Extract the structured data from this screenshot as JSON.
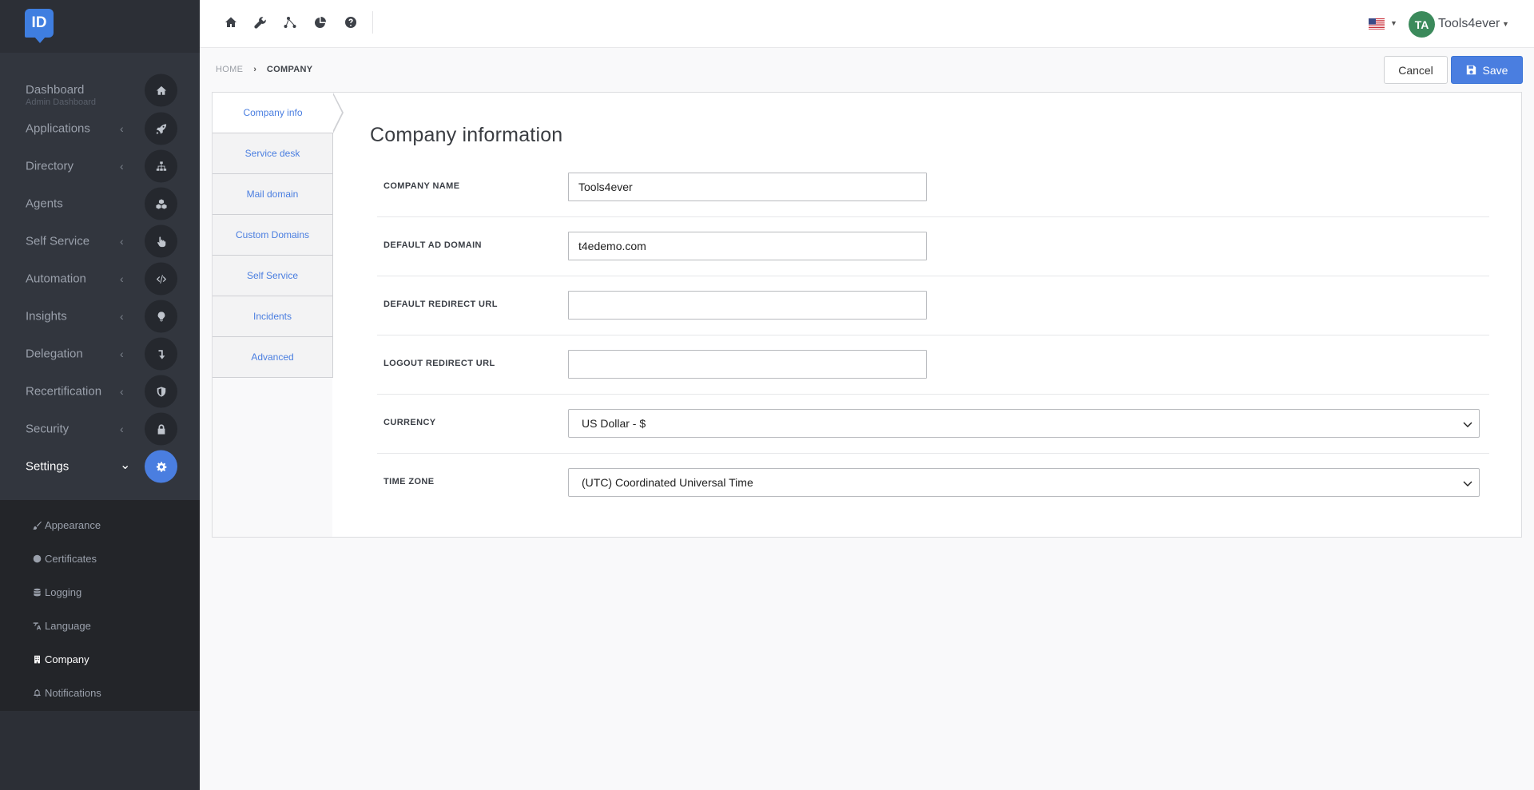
{
  "app": {
    "logo_text": "ID"
  },
  "sidebar": {
    "items": [
      {
        "label": "Dashboard",
        "sublabel": "Admin Dashboard",
        "icon": "home-icon",
        "has_arrow": false
      },
      {
        "label": "Applications",
        "icon": "rocket-icon",
        "has_arrow": true
      },
      {
        "label": "Directory",
        "icon": "sitemap-icon",
        "has_arrow": true
      },
      {
        "label": "Agents",
        "icon": "cubes-icon",
        "has_arrow": false
      },
      {
        "label": "Self Service",
        "icon": "hand-pointer-icon",
        "has_arrow": true
      },
      {
        "label": "Automation",
        "icon": "code-icon",
        "has_arrow": true
      },
      {
        "label": "Insights",
        "icon": "lightbulb-icon",
        "has_arrow": true
      },
      {
        "label": "Delegation",
        "icon": "level-down-icon",
        "has_arrow": true
      },
      {
        "label": "Recertification",
        "icon": "shield-icon",
        "has_arrow": true
      },
      {
        "label": "Security",
        "icon": "lock-icon",
        "has_arrow": true
      },
      {
        "label": "Settings",
        "icon": "cog-icon",
        "has_arrow": true,
        "active": true
      }
    ],
    "arrow_collapsed": "‹",
    "arrow_expanded": "⌄",
    "submenu": [
      {
        "label": "Appearance",
        "icon": "brush-icon"
      },
      {
        "label": "Certificates",
        "icon": "circle-icon"
      },
      {
        "label": "Logging",
        "icon": "database-icon"
      },
      {
        "label": "Language",
        "icon": "language-icon"
      },
      {
        "label": "Company",
        "icon": "building-icon",
        "active": true
      },
      {
        "label": "Notifications",
        "icon": "bell-icon"
      }
    ]
  },
  "topbar": {
    "icons": [
      "home-icon",
      "wrench-icon",
      "share-nodes-icon",
      "pie-chart-icon",
      "question-circle-icon"
    ],
    "language_flag": "us-flag-icon",
    "user_initials": "TA",
    "user_name": "Tools4ever",
    "caret": "▼"
  },
  "breadcrumb": {
    "home": "HOME",
    "separator": "›",
    "current": "COMPANY"
  },
  "actions": {
    "cancel_label": "Cancel",
    "save_label": "Save"
  },
  "tabs": [
    {
      "label": "Company info",
      "active": true
    },
    {
      "label": "Service desk"
    },
    {
      "label": "Mail domain"
    },
    {
      "label": "Custom Domains"
    },
    {
      "label": "Self Service"
    },
    {
      "label": "Incidents"
    },
    {
      "label": "Advanced"
    }
  ],
  "form": {
    "title": "Company information",
    "company_name": {
      "label": "COMPANY NAME",
      "value": "Tools4ever"
    },
    "default_ad_domain": {
      "label": "DEFAULT AD DOMAIN",
      "value": "t4edemo.com"
    },
    "default_redirect_url": {
      "label": "DEFAULT REDIRECT URL",
      "value": ""
    },
    "logout_redirect_url": {
      "label": "LOGOUT REDIRECT URL",
      "value": ""
    },
    "currency": {
      "label": "CURRENCY",
      "selected": "US Dollar - $"
    },
    "time_zone": {
      "label": "TIME ZONE",
      "selected": "(UTC) Coordinated Universal Time"
    }
  },
  "colors": {
    "accent": "#4a7ee0",
    "sidebar_bg": "#32363e",
    "submenu_bg": "#232529",
    "avatar_bg": "#3b8a5b"
  }
}
